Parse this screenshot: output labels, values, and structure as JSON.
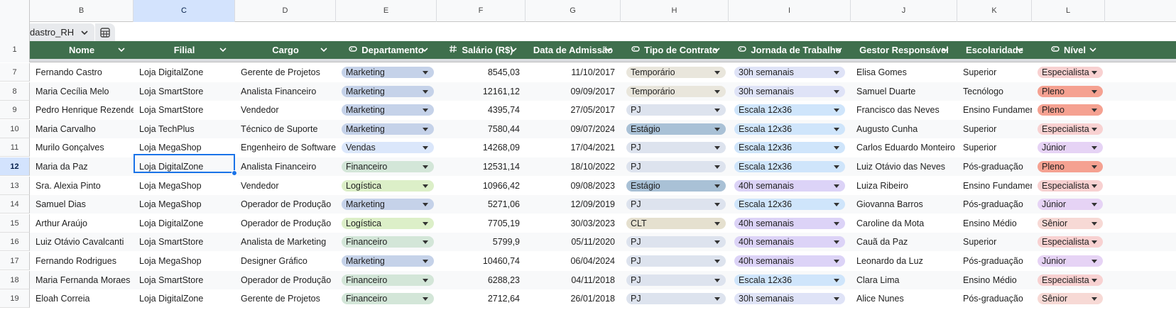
{
  "column_letters": [
    "B",
    "C",
    "D",
    "E",
    "F",
    "G",
    "H",
    "I",
    "J",
    "K",
    "L"
  ],
  "selected_column": "C",
  "table_tab": {
    "name": "dastro_RH",
    "chevron_icon": "chevron-down-icon",
    "table_icon": "table-grid-icon"
  },
  "header_row_number": "1",
  "headers": [
    {
      "label": "Nome",
      "type_icon": ""
    },
    {
      "label": "Filial",
      "type_icon": ""
    },
    {
      "label": "Cargo",
      "type_icon": ""
    },
    {
      "label": "Departamento",
      "type_icon": "dropdown-chip-icon"
    },
    {
      "label": "Salário (R$)",
      "type_icon": "hash-icon"
    },
    {
      "label": "Data de Admissão",
      "type_icon": ""
    },
    {
      "label": "Tipo de Contrato",
      "type_icon": "dropdown-chip-icon"
    },
    {
      "label": "Jornada de Trabalho",
      "type_icon": "dropdown-chip-icon"
    },
    {
      "label": "Gestor Responsável",
      "type_icon": ""
    },
    {
      "label": "Escolaridade",
      "type_icon": ""
    },
    {
      "label": "Nível",
      "type_icon": "dropdown-chip-icon"
    }
  ],
  "selected_row": "12",
  "rows": [
    {
      "n": "7",
      "nome": "Fernando Castro",
      "filial": "Loja DigitalZone",
      "cargo": "Gerente de Projetos",
      "depto": "Marketing",
      "salario": "8545,03",
      "data": "11/10/2017",
      "contrato": "Temporário",
      "jornada": "30h semanais",
      "gestor": "Elisa Gomes",
      "escolaridade": "Superior",
      "nivel": "Especialista"
    },
    {
      "n": "8",
      "nome": "Maria Cecília Melo",
      "filial": "Loja SmartStore",
      "cargo": "Analista Financeiro",
      "depto": "Marketing",
      "salario": "12161,12",
      "data": "09/09/2017",
      "contrato": "Temporário",
      "jornada": "30h semanais",
      "gestor": "Samuel Duarte",
      "escolaridade": "Tecnólogo",
      "nivel": "Pleno"
    },
    {
      "n": "9",
      "nome": "Pedro Henrique Rezende",
      "filial": "Loja SmartStore",
      "cargo": "Vendedor",
      "depto": "Marketing",
      "salario": "4395,74",
      "data": "27/05/2017",
      "contrato": "PJ",
      "jornada": "Escala 12x36",
      "gestor": "Francisco das Neves",
      "escolaridade": "Ensino Fundament",
      "nivel": "Pleno"
    },
    {
      "n": "10",
      "nome": "Maria Carvalho",
      "filial": "Loja TechPlus",
      "cargo": "Técnico de Suporte",
      "depto": "Marketing",
      "salario": "7580,44",
      "data": "09/07/2024",
      "contrato": "Estágio",
      "jornada": "Escala 12x36",
      "gestor": "Augusto Cunha",
      "escolaridade": "Superior",
      "nivel": "Especialista"
    },
    {
      "n": "11",
      "nome": "Murilo Gonçalves",
      "filial": "Loja MegaShop",
      "cargo": "Engenheiro de Software",
      "depto": "Vendas",
      "salario": "14268,09",
      "data": "17/04/2021",
      "contrato": "PJ",
      "jornada": "Escala 12x36",
      "gestor": "Carlos Eduardo Monteiro",
      "escolaridade": "Superior",
      "nivel": "Júnior"
    },
    {
      "n": "12",
      "nome": "Maria da Paz",
      "filial": "Loja DigitalZone",
      "cargo": "Analista Financeiro",
      "depto": "Financeiro",
      "salario": "12531,14",
      "data": "18/10/2022",
      "contrato": "PJ",
      "jornada": "Escala 12x36",
      "gestor": "Luiz Otávio das Neves",
      "escolaridade": "Pós-graduação",
      "nivel": "Pleno"
    },
    {
      "n": "13",
      "nome": "Sra. Alexia Pinto",
      "filial": "Loja MegaShop",
      "cargo": "Vendedor",
      "depto": "Logística",
      "salario": "10966,42",
      "data": "09/08/2023",
      "contrato": "Estágio",
      "jornada": "40h semanais",
      "gestor": "Luiza Ribeiro",
      "escolaridade": "Ensino Fundament",
      "nivel": "Especialista"
    },
    {
      "n": "14",
      "nome": "Samuel Dias",
      "filial": "Loja MegaShop",
      "cargo": "Operador de Produção",
      "depto": "Marketing",
      "salario": "5271,06",
      "data": "12/09/2019",
      "contrato": "PJ",
      "jornada": "Escala 12x36",
      "gestor": "Giovanna Barros",
      "escolaridade": "Pós-graduação",
      "nivel": "Júnior"
    },
    {
      "n": "15",
      "nome": "Arthur Araújo",
      "filial": "Loja DigitalZone",
      "cargo": "Operador de Produção",
      "depto": "Logística",
      "salario": "7705,19",
      "data": "30/03/2023",
      "contrato": "CLT",
      "jornada": "40h semanais",
      "gestor": "Caroline da Mota",
      "escolaridade": "Ensino Médio",
      "nivel": "Sênior"
    },
    {
      "n": "16",
      "nome": "Luiz Otávio Cavalcanti",
      "filial": "Loja SmartStore",
      "cargo": "Analista de Marketing",
      "depto": "Financeiro",
      "salario": "5799,9",
      "data": "05/11/2020",
      "contrato": "PJ",
      "jornada": "40h semanais",
      "gestor": "Cauã da Paz",
      "escolaridade": "Superior",
      "nivel": "Especialista"
    },
    {
      "n": "17",
      "nome": "Fernando Rodrigues",
      "filial": "Loja MegaShop",
      "cargo": "Designer Gráfico",
      "depto": "Marketing",
      "salario": "10460,74",
      "data": "06/04/2024",
      "contrato": "PJ",
      "jornada": "40h semanais",
      "gestor": "Leonardo da Luz",
      "escolaridade": "Pós-graduação",
      "nivel": "Júnior"
    },
    {
      "n": "18",
      "nome": "Maria Fernanda Moraes",
      "filial": "Loja SmartStore",
      "cargo": "Operador de Produção",
      "depto": "Financeiro",
      "salario": "6288,23",
      "data": "04/11/2018",
      "contrato": "PJ",
      "jornada": "Escala 12x36",
      "gestor": "Clara Lima",
      "escolaridade": "Ensino Médio",
      "nivel": "Especialista"
    },
    {
      "n": "19",
      "nome": "Eloah Correia",
      "filial": "Loja DigitalZone",
      "cargo": "Gerente de Projetos",
      "depto": "Financeiro",
      "salario": "2712,64",
      "data": "26/01/2018",
      "contrato": "PJ",
      "jornada": "30h semanais",
      "gestor": "Alice Nunes",
      "escolaridade": "Pós-graduação",
      "nivel": "Sênior"
    }
  ],
  "chip_colors": {
    "depto": {
      "Marketing": "#c5d2e9",
      "Vendas": "#dbe7fb",
      "Financeiro": "#d3e6d8",
      "Logística": "#dcefc8"
    },
    "contrato": {
      "Temporário": "#e9e6dc",
      "PJ": "#dde3ee",
      "Estágio": "#a9c1d6",
      "CLT": "#e5e0cf"
    },
    "jornada": {
      "30h semanais": "#dfe3f7",
      "Escala 12x36": "#cfe5fb",
      "40h semanais": "#dcd3f7"
    },
    "nivel": {
      "Especialista": "#f8d1d1",
      "Pleno": "#f5a191",
      "Júnior": "#e6d3f5",
      "Sênior": "#f7d9d5"
    }
  },
  "header_bg": "#3f6f4d",
  "selection_color": "#1a73e8"
}
